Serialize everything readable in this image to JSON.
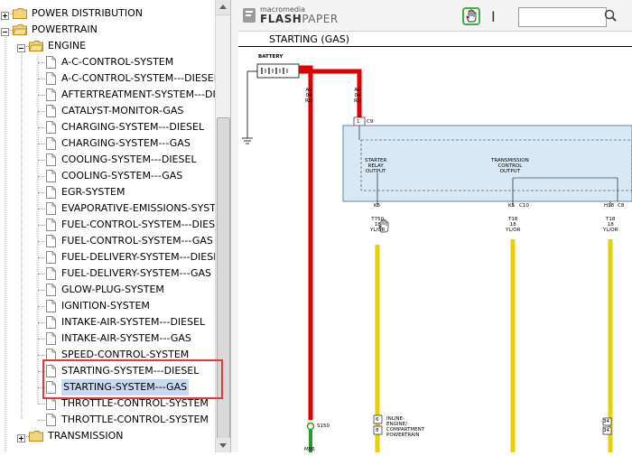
{
  "tree": {
    "items": [
      {
        "label": "POWER DISTRIBUTION",
        "kind": "folder",
        "level": 0
      },
      {
        "label": "POWERTRAIN",
        "kind": "folder-open",
        "level": 0
      },
      {
        "label": "ENGINE",
        "kind": "folder-open",
        "level": 1
      },
      {
        "label": "A-C-CONTROL-SYSTEM",
        "kind": "doc",
        "level": 2
      },
      {
        "label": "A-C-CONTROL-SYSTEM---DIESEL",
        "kind": "doc",
        "level": 2
      },
      {
        "label": "AFTERTREATMENT-SYSTEM---DIESEL",
        "kind": "doc",
        "level": 2
      },
      {
        "label": "CATALYST-MONITOR-GAS",
        "kind": "doc",
        "level": 2
      },
      {
        "label": "CHARGING-SYSTEM---DIESEL",
        "kind": "doc",
        "level": 2
      },
      {
        "label": "CHARGING-SYSTEM---GAS",
        "kind": "doc",
        "level": 2
      },
      {
        "label": "COOLING-SYSTEM---DIESEL",
        "kind": "doc",
        "level": 2
      },
      {
        "label": "COOLING-SYSTEM---GAS",
        "kind": "doc",
        "level": 2
      },
      {
        "label": "EGR-SYSTEM",
        "kind": "doc",
        "level": 2
      },
      {
        "label": "EVAPORATIVE-EMISSIONS-SYSTEM",
        "kind": "doc",
        "level": 2
      },
      {
        "label": "FUEL-CONTROL-SYSTEM---DIESEL",
        "kind": "doc",
        "level": 2
      },
      {
        "label": "FUEL-CONTROL-SYSTEM---GAS",
        "kind": "doc",
        "level": 2
      },
      {
        "label": "FUEL-DELIVERY-SYSTEM---DIESEL",
        "kind": "doc",
        "level": 2
      },
      {
        "label": "FUEL-DELIVERY-SYSTEM---GAS",
        "kind": "doc",
        "level": 2
      },
      {
        "label": "GLOW-PLUG-SYSTEM",
        "kind": "doc",
        "level": 2
      },
      {
        "label": "IGNITION-SYSTEM",
        "kind": "doc",
        "level": 2
      },
      {
        "label": "INTAKE-AIR-SYSTEM---DIESEL",
        "kind": "doc",
        "level": 2
      },
      {
        "label": "INTAKE-AIR-SYSTEM---GAS",
        "kind": "doc",
        "level": 2
      },
      {
        "label": "SPEED-CONTROL-SYSTEM",
        "kind": "doc",
        "level": 2
      },
      {
        "label": "STARTING-SYSTEM---DIESEL",
        "kind": "doc",
        "level": 2
      },
      {
        "label": "STARTING-SYSTEM---GAS",
        "kind": "doc",
        "level": 2,
        "selected": true
      },
      {
        "label": "THROTTLE-CONTROL-SYSTEM",
        "kind": "doc",
        "level": 2
      },
      {
        "label": "THROTTLE-CONTROL-SYSTEM",
        "kind": "doc",
        "level": 2
      },
      {
        "label": "TRANSMISSION",
        "kind": "folder",
        "level": 1
      }
    ]
  },
  "viewer": {
    "logo_top": "macromedia",
    "logo_main": "FLASH",
    "logo_sub": "PAPER",
    "search_value": "",
    "page_title": "STARTING (GAS)"
  },
  "diagram": {
    "battery": "BATTERY",
    "w1": [
      "A0",
      "04",
      "RD"
    ],
    "w2": [
      "A0",
      "04",
      "RD"
    ],
    "pin_c9": "1",
    "conn_c9": "C9",
    "starter": [
      "STARTER",
      "RELAY",
      "OUTPUT"
    ],
    "trans": [
      "TRANSMISSION",
      "CONTROL",
      "OUTPUT"
    ],
    "k5a": "K5",
    "k5b": "K5",
    "c10": "C10",
    "h18": "H18",
    "c8": "C8",
    "w3": [
      "T750",
      "18",
      "YL/OR"
    ],
    "w4": [
      "T18",
      "18",
      "YL/OR"
    ],
    "w5": [
      "T18",
      "18",
      "YL/OR"
    ],
    "s150": "S150",
    "pin6": "6",
    "pin8": "8",
    "loc": [
      "INLINE-",
      "ENGINE/",
      "COMPARTMENT",
      "POWERTRAIN"
    ],
    "pin34": "34",
    "pin34b": "34",
    "bottom_lbl": "M06"
  },
  "colors": {
    "red": "#e00000",
    "yellow": "#e6d200",
    "green": "#2a9a2a",
    "box": "#d8e9f5"
  }
}
